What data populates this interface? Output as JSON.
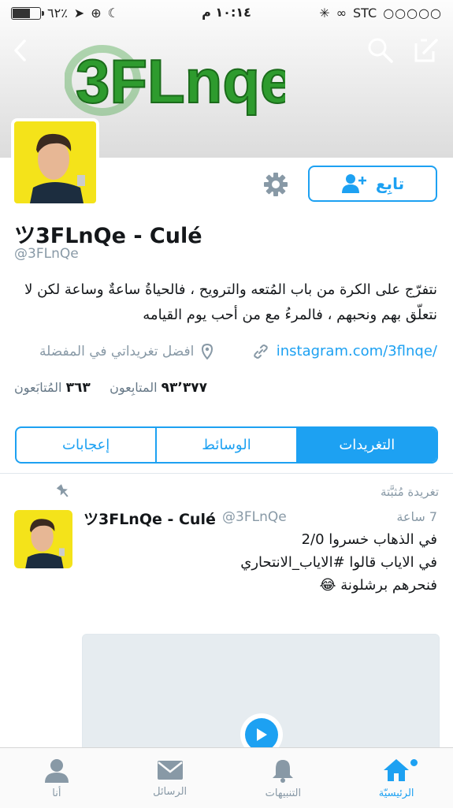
{
  "status_bar": {
    "carrier": "STC",
    "time": "١٠:١٤ م",
    "battery": "٦٢٪",
    "battery_level": 0.62
  },
  "header": {
    "banner_text": "3FLnqe",
    "back_icon": "chevron-left-icon",
    "search_icon": "search-icon",
    "compose_icon": "compose-icon"
  },
  "profile": {
    "name": "ツ3FLnQe - Culé",
    "handle": "@3FLnQe",
    "follow_label": "تابِع",
    "settings_icon": "gear-icon",
    "bio_line1": "نتفرّج على الكرة      من باب المُتعه والترويح ، فالحياةُ ساعةٌ وساعة لكن لا",
    "bio_line2": "نتعلّق بهم ونحبهم ، فالمرءُ مع من أحب يوم القيامه",
    "link": "instagram.com/3flnqe/",
    "location": "افضل تغريداتي في المفضلة",
    "followers_count": "٩٣٬٣٧٧",
    "followers_label": "المتابِعون",
    "following_count": "٣٦٣",
    "following_label": "المُتابَعون"
  },
  "tabs": [
    {
      "label": "إعجابات",
      "active": false
    },
    {
      "label": "الوسائط",
      "active": false
    },
    {
      "label": "التغريدات",
      "active": true
    }
  ],
  "pinned_label": "تغريدة مُثبَّتة",
  "tweet": {
    "name": "ツ3FLnQe - Culé",
    "handle": "@3FLnQe",
    "time": "7 ساعة",
    "line1": "في الذهاب خسروا 2/0",
    "line2": "في الاياب قالوا #الاياب_الانتحاري",
    "line3": "فنحرهم برشلونة 😂"
  },
  "tab_bar": [
    {
      "label": "أنا",
      "icon": "person-icon"
    },
    {
      "label": "الرسائل",
      "icon": "envelope-icon"
    },
    {
      "label": "التنبيهات",
      "icon": "bell-icon"
    },
    {
      "label": "الرئيسيّة",
      "icon": "home-icon",
      "active": true
    }
  ],
  "colors": {
    "accent": "#1da1f2",
    "banner_green": "#2e9b2e"
  }
}
